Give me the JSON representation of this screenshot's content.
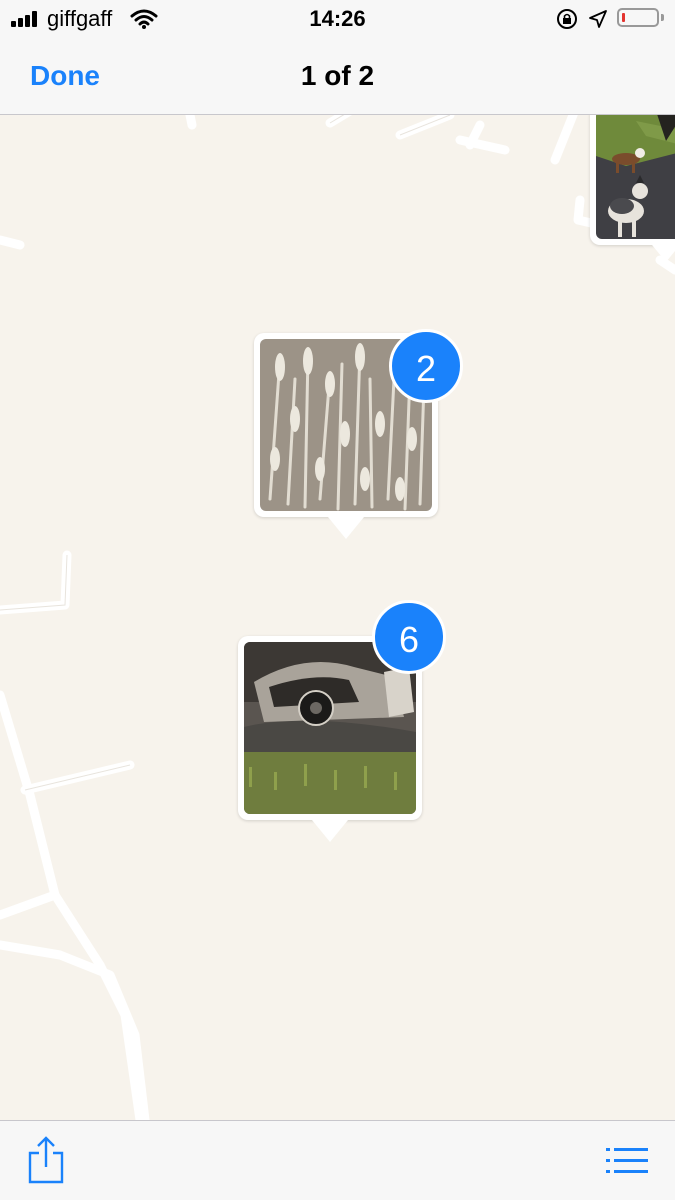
{
  "status_bar": {
    "carrier": "giffgaff",
    "time": "14:26",
    "battery_level": 0.1,
    "battery_color": "#e3342f"
  },
  "nav": {
    "done_label": "Done",
    "title": "1 of 2"
  },
  "map": {
    "background_color": "#f7f3ec",
    "pins": [
      {
        "name": "wheat-field-photo",
        "count": "2"
      },
      {
        "name": "burnt-car-photo",
        "count": "6"
      },
      {
        "name": "dogs-on-road-photo",
        "count": ""
      }
    ]
  },
  "toolbar": {
    "share_icon": "share-icon",
    "list_icon": "list-icon"
  },
  "colors": {
    "accent": "#1a82fb"
  }
}
